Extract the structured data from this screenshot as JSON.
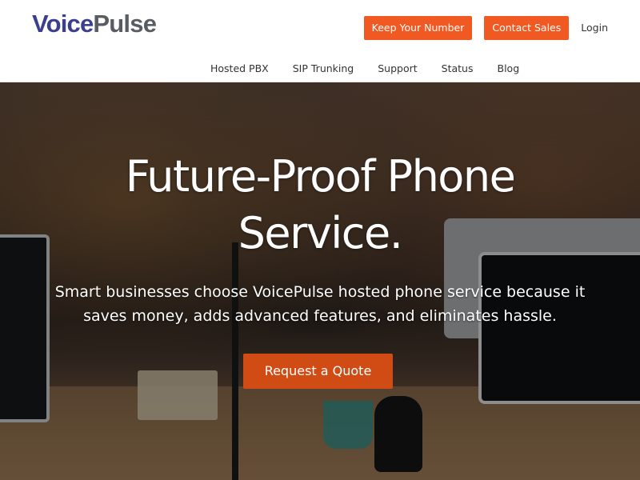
{
  "brand": {
    "logo_voice": "Voice",
    "logo_pulse": "Pulse"
  },
  "header": {
    "actions": {
      "keep_number": "Keep Your Number",
      "contact_sales": "Contact Sales",
      "login": "Login"
    },
    "nav": [
      "Hosted PBX",
      "SIP Trunking",
      "Support",
      "Status",
      "Blog"
    ]
  },
  "hero": {
    "title_line1": "Future-Proof Phone",
    "title_line2": "Service.",
    "subtitle": "Smart businesses choose VoicePulse hosted phone service because it saves money, adds advanced features, and eliminates hassle.",
    "cta": "Request a Quote"
  },
  "colors": {
    "accent": "#f05a22",
    "cta": "#d14c15",
    "logo_blue": "#3a3f8e",
    "logo_gray": "#595c62"
  }
}
